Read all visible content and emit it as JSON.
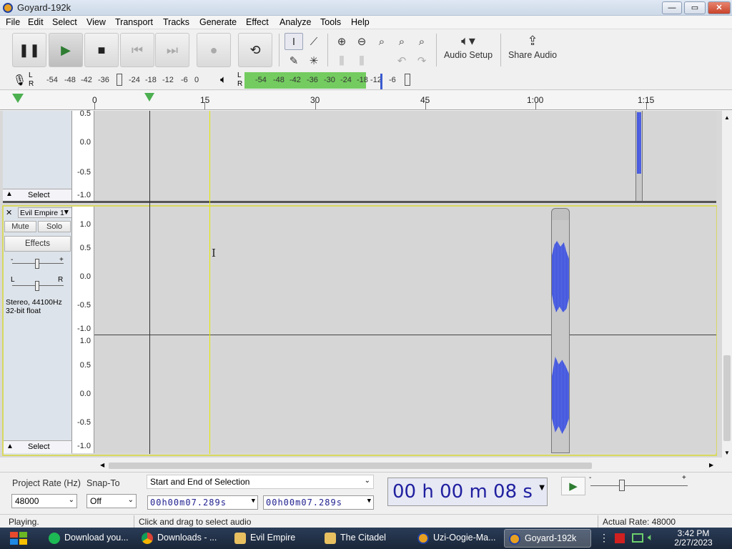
{
  "window": {
    "title": "Goyard-192k",
    "controls": {
      "minimize": "—",
      "maximize": "▭",
      "close": "✕"
    }
  },
  "menu": [
    "File",
    "Edit",
    "Select",
    "View",
    "Transport",
    "Tracks",
    "Generate",
    "Effect",
    "Analyze",
    "Tools",
    "Help"
  ],
  "toolbar": {
    "transport_icons": [
      "pause-icon",
      "play-icon",
      "stop-icon",
      "skip-start-icon",
      "skip-end-icon",
      "record-icon",
      "loop-icon"
    ],
    "audio_setup": "Audio Setup",
    "share_audio": "Share Audio"
  },
  "meters": {
    "record": {
      "l": "L",
      "r": "R",
      "ticks": [
        "-54",
        "-48",
        "-42",
        "-36",
        "-24",
        "-18",
        "-12",
        "-6",
        "0"
      ]
    },
    "playback": {
      "l": "L",
      "r": "R",
      "ticks": [
        "-54",
        "-48",
        "-42",
        "-36",
        "-30",
        "-24",
        "-18",
        "-12",
        "-6"
      ]
    },
    "playback_level": 0.72
  },
  "timeline": {
    "ticks": [
      "0",
      "15",
      "30",
      "45",
      "1:00",
      "1:15"
    ]
  },
  "track1": {
    "scale": [
      "0.5",
      "0.0",
      "-0.5",
      "-1.0"
    ],
    "select": "Select"
  },
  "track2": {
    "name": "Evil Empire 1",
    "mute": "Mute",
    "solo": "Solo",
    "effects": "Effects",
    "gain_minus": "-",
    "gain_plus": "+",
    "pan_l": "L",
    "pan_r": "R",
    "info1": "Stereo, 44100Hz",
    "info2": "32-bit float",
    "scale_top": [
      "1.0",
      "0.5",
      "0.0",
      "-0.5",
      "-1.0"
    ],
    "scale_bottom": [
      "1.0",
      "0.5",
      "0.0",
      "-0.5",
      "-1.0"
    ],
    "select": "Select"
  },
  "bottom": {
    "project_rate_label": "Project Rate (Hz)",
    "snap_to_label": "Snap-To",
    "project_rate": "48000",
    "snap_to": "Off",
    "selection_mode": "Start and End of Selection",
    "sel_start": "00h00m07.289s",
    "sel_end": "00h00m07.289s",
    "big_time": "00 h 00 m 08 s",
    "play_at_speed_minus": "-",
    "play_at_speed_plus": "+"
  },
  "status": {
    "left": "Playing.",
    "middle": "Click and drag to select audio",
    "right": "Actual Rate: 48000"
  },
  "taskbar": {
    "items": [
      "Download you...",
      "Downloads - ...",
      "Evil Empire",
      "The Citadel",
      "Uzi-Oogie-Ma...",
      "Goyard-192k"
    ],
    "clock_time": "3:42 PM",
    "clock_date": "2/27/2023"
  }
}
